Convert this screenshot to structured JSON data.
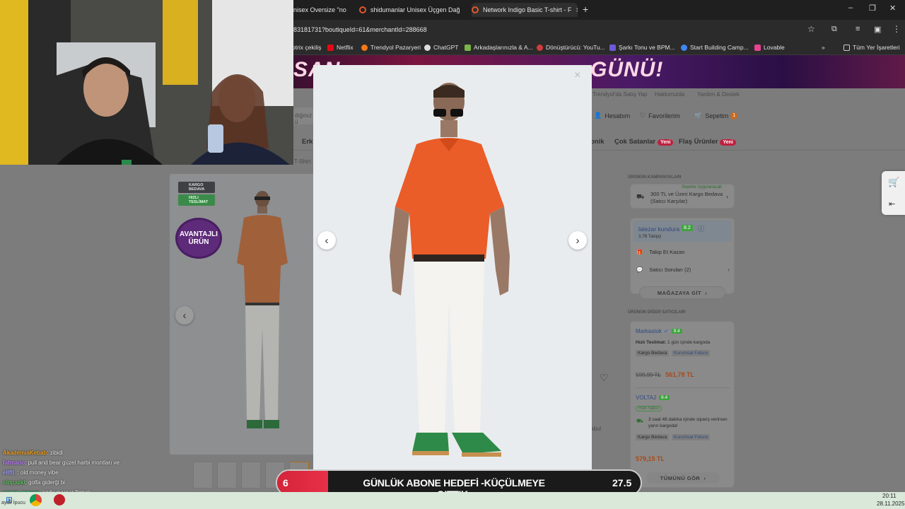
{
  "browser": {
    "tabs": [
      {
        "title": "nisex Oversize \"no",
        "close": "×"
      },
      {
        "title": "shidumanlar Unisex Üçgen Dağ",
        "close": "×"
      },
      {
        "title": "Network Indigo Basic T-shirt - F",
        "close": "×"
      }
    ],
    "new_tab": "+",
    "window_controls": [
      "–",
      "❐",
      "✕"
    ],
    "url": "83181731?boutiqueId=61&merchantId=288668",
    "bookmarks": [
      {
        "label": "otrix çekiliş",
        "color": "#777777"
      },
      {
        "label": "Netflix",
        "color": "#e50914"
      },
      {
        "label": "Trendyol Pazaryeri",
        "color": "#f27a1a"
      },
      {
        "label": "ChatGPT",
        "color": "#dddddd"
      },
      {
        "label": "Arkadaşlarınızla & A...",
        "color": "#7ab648"
      },
      {
        "label": "Dönüştürücü: YouTu...",
        "color": "#d23c3c"
      },
      {
        "label": "Şarkı Tonu ve BPM...",
        "color": "#6b5bd6"
      },
      {
        "label": "Start Building Camp...",
        "color": "#4285f4"
      },
      {
        "label": "Lovable",
        "color": "#e84393"
      }
    ],
    "bookmarks_more": "»",
    "all_bookmarks": "Tüm Yer İşaretleri"
  },
  "site": {
    "banner_text": "SAN",
    "banner_text_right": "GÜNÜ!",
    "top_links": [
      "Trendyol'da Satış Yap",
      "Hakkımızda",
      "Yardım & Destek"
    ],
    "search_placeholder": "dığınız ü",
    "account": "Hesabım",
    "favorites": "Favorilerim",
    "cart": "Sepetim",
    "cart_count": "1",
    "nav_left": "Erk",
    "nav_items": [
      {
        "label": "onik",
        "badge": ""
      },
      {
        "label": "Çok Satanlar",
        "badge": "Yeni"
      },
      {
        "label": "Flaş Ürünler",
        "badge": "Yeni"
      }
    ],
    "breadcrumb": "T-Shirt"
  },
  "product": {
    "badges": {
      "cargo": "KARGO BEDAVA",
      "fast": "HIZLI TESLİMAT"
    },
    "sticker": "AVANTAJLI ÜRÜN",
    "prev": "‹",
    "partial_link": "abul"
  },
  "modal": {
    "close": "×",
    "prev": "‹",
    "next": "›"
  },
  "sidebar": {
    "campaigns_title": "ÜRÜNÜN KAMPANYALARI",
    "campaign_tag": "Sepette Uygulanacak",
    "campaign_text": "300 TL ve Üzeri Kargo Bedava (Satıcı Karşılar)",
    "seller_name": "lalezar kundura",
    "seller_score": "8.2",
    "seller_followers": "3,7B Takipçi",
    "follow": "Takip Et Kazan",
    "seller_questions": "Satıcı Soruları (2)",
    "store_button": "MAĞAZAYA GİT",
    "other_sellers_title": "ÜRÜNÜN DİĞER SATICILARI",
    "sellers": [
      {
        "name": "Markastok",
        "score": "9.4",
        "info_label": "Hızlı Teslimat:",
        "info": "1 gün içinde kargoda",
        "tags": [
          "Kargo Bedava",
          "Kurumsal Fatura"
        ],
        "old_price": "599,99 TL",
        "price": "561,78 TL"
      },
      {
        "name": "VOLTAJ",
        "score": "9.4",
        "fast_tag": "Hızlı Satıcı",
        "delivery": "3 saat 48 dakika içinde sipariş verirsen yarın kargoda!",
        "tags": [
          "Kargo Bedava",
          "Kurumsal Fatura"
        ],
        "price": "579,15 TL"
      }
    ],
    "see_all": "TÜMÜNÜ GÖR"
  },
  "stream": {
    "chat": [
      {
        "user": "AkademiaKebab",
        "msg": ": zibidi",
        "color": "#f0a020"
      },
      {
        "user": "fatmaoo",
        "msg": ": pull and bear güzel harbi montları ve",
        "color": "#c080ff"
      },
      {
        "user": "ellfll_",
        "msg": ": old money vibe",
        "color": "#a0a0ff"
      },
      {
        "user": "sinpazkl",
        "msg": ": golfa giderği bi",
        "color": "#60c060"
      },
      {
        "user": "ozcan_tursan",
        "msg": ": kodu oyunar firmalı",
        "color": "#40c080"
      }
    ],
    "goal_label": "GÜNLÜK ABONE HEDEFİ -KÜÇÜLMEYE GITTIK-",
    "goal_current": "6",
    "goal_target": "27.5",
    "goal_progress": 0.14
  },
  "taskbar": {
    "time": "20:11",
    "date": "28.11.2025",
    "left_text": "ayak İpucu"
  },
  "colors": {
    "accent": "#f27a1a",
    "goal_red": "#e0283f",
    "score_green": "#3fa33f",
    "link_blue": "#3366aa"
  }
}
